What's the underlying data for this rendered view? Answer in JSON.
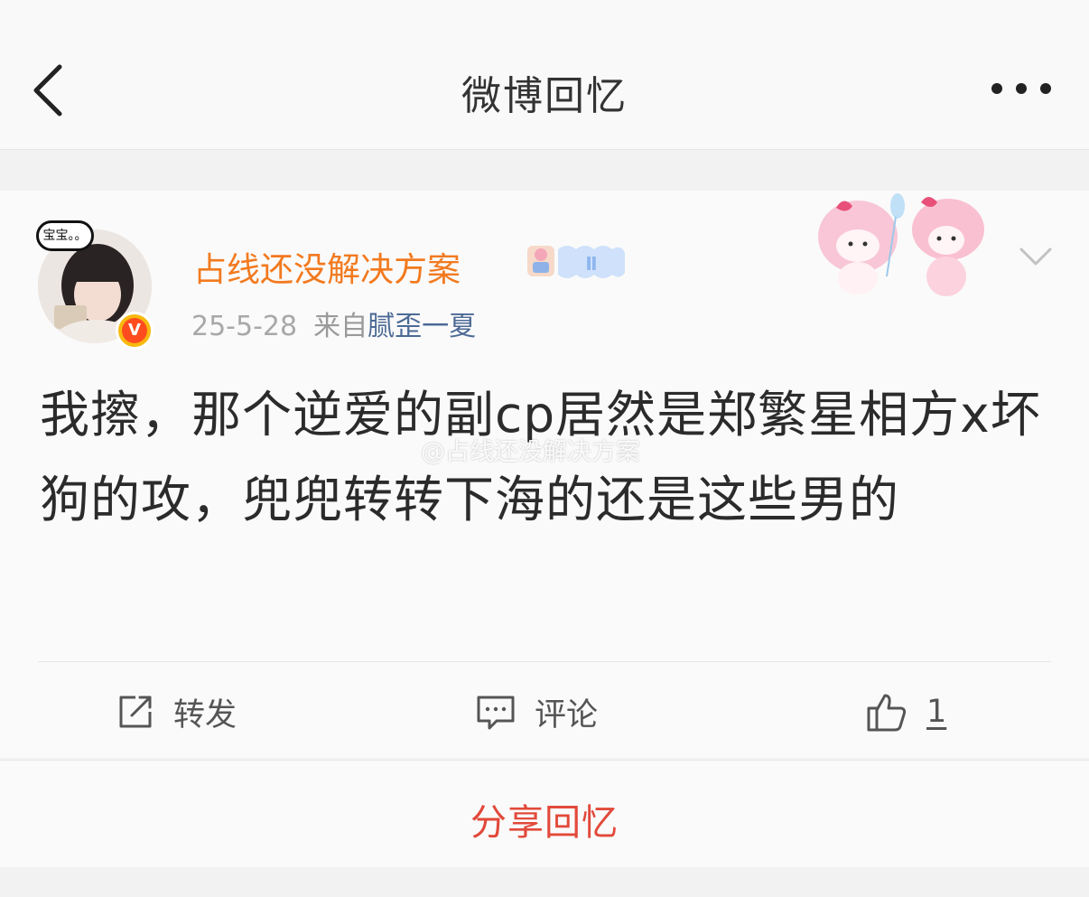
{
  "nav": {
    "title": "微博回忆"
  },
  "post": {
    "author": "占线还没解决方案",
    "avatar_bubble": "宝宝。。",
    "verified_badge": "V",
    "member_level": "Ⅱ",
    "date": "25-5-28",
    "source_prefix": "来自",
    "source_name": "腻歪一夏",
    "content": "我擦，那个逆爱的副cp居然是郑繁星相方x坏狗的攻，兜兜转转下海的还是这些男的",
    "watermark": "@占线还没解决方案"
  },
  "actions": {
    "repost_label": "转发",
    "comment_label": "评论",
    "like_count": "1"
  },
  "share": {
    "label": "分享回忆"
  },
  "colors": {
    "username": "#f27a1f",
    "source_link": "#4c6a95",
    "share": "#e2493a"
  },
  "icons": [
    "back-arrow-icon",
    "more-dots-icon",
    "chevron-down-icon",
    "repost-icon",
    "comment-icon",
    "thumbs-up-icon"
  ]
}
